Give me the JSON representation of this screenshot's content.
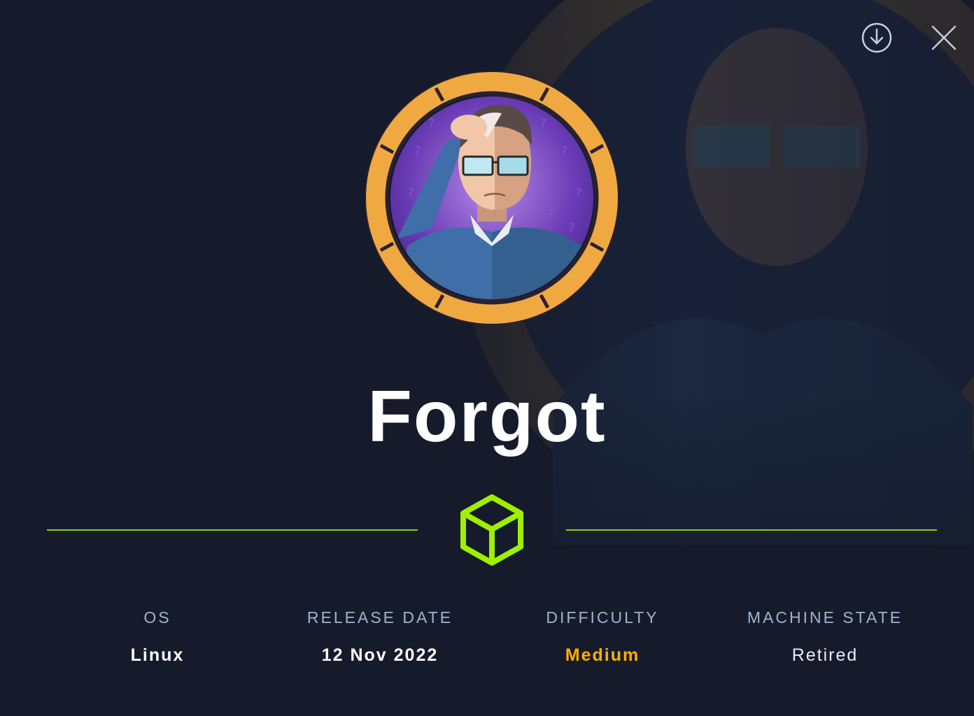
{
  "machine": {
    "name": "Forgot"
  },
  "actions": {
    "download_icon": "download-icon",
    "close_icon": "close-icon"
  },
  "stats": {
    "os_label": "OS",
    "os_value": "Linux",
    "release_label": "RELEASE DATE",
    "release_value": "12 Nov 2022",
    "difficulty_label": "DIFFICULTY",
    "difficulty_value": "Medium",
    "state_label": "MACHINE STATE",
    "state_value": "Retired"
  },
  "colors": {
    "background": "#151b2b",
    "accent_green": "#9fef00",
    "difficulty_medium": "#ffaf00",
    "ring_orange": "#f0a940",
    "label_gray": "#a4b1cd"
  }
}
